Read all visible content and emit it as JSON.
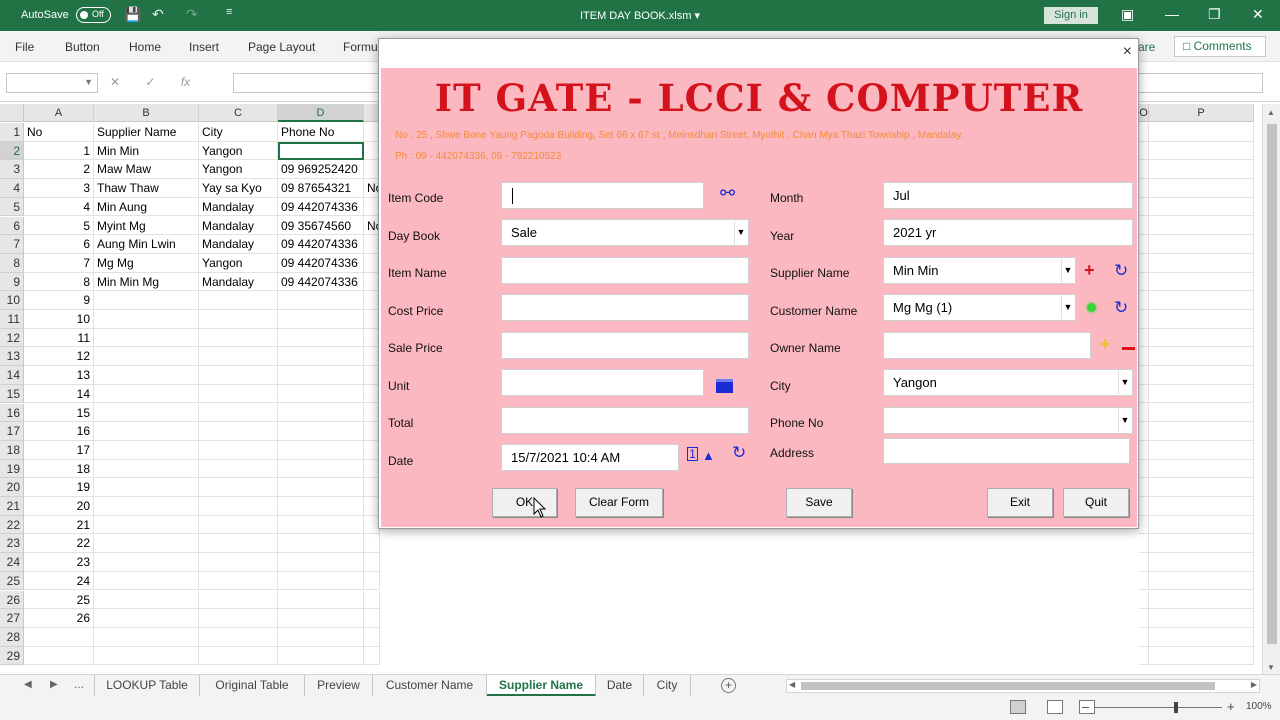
{
  "titlebar": {
    "autosave_label": "AutoSave",
    "autosave_state": "Off",
    "file_title": "ITEM DAY BOOK.xlsm",
    "title_dropdown": "▾",
    "sign_in": "Sign in"
  },
  "ribbon": {
    "tabs": [
      "File",
      "Button",
      "Home",
      "Insert",
      "Page Layout",
      "Formu"
    ],
    "share_partial": "are",
    "comments": "Comments"
  },
  "formula_bar": {
    "fx": "fx",
    "name_box": "",
    "content": ""
  },
  "sheet": {
    "columns": [
      "A",
      "B",
      "C",
      "D",
      "O",
      "P"
    ],
    "active_column": "D",
    "row_numbers": [
      "1",
      "2",
      "3",
      "4",
      "5",
      "6",
      "7",
      "8",
      "9",
      "10",
      "11",
      "12",
      "13",
      "14",
      "15",
      "16",
      "17",
      "18",
      "19",
      "20",
      "21",
      "22",
      "23",
      "24",
      "25",
      "26",
      "27",
      "28",
      "29"
    ],
    "header_row": [
      "No",
      "Supplier Name",
      "City",
      "Phone No"
    ],
    "data_rows": [
      [
        "1",
        "Min Min",
        "Yangon",
        ""
      ],
      [
        "2",
        "Maw Maw",
        "Yangon",
        "09 969252420"
      ],
      [
        "3",
        "Thaw Thaw",
        "Yay sa Kyo",
        "09 87654321"
      ],
      [
        "4",
        "Min Aung",
        "Mandalay",
        "09 442074336"
      ],
      [
        "5",
        "Myint Mg",
        "Mandalay",
        "09 35674560"
      ],
      [
        "6",
        "Aung Min Lwin",
        "Mandalay",
        "09 442074336"
      ],
      [
        "7",
        "Mg Mg",
        "Yangon",
        "09 442074336"
      ],
      [
        "8",
        "Min Min Mg",
        "Mandalay",
        "09 442074336"
      ]
    ],
    "col_e_fragments": {
      "row4": "No",
      "row6": "No"
    },
    "col_a_numbers": [
      "9",
      "10",
      "11",
      "12",
      "13",
      "14",
      "15",
      "16",
      "17",
      "18",
      "19",
      "20",
      "21",
      "22",
      "23",
      "24",
      "25",
      "26"
    ]
  },
  "sheet_tabs": {
    "ellipsis": "...",
    "tabs": [
      "LOOKUP Table",
      "Original Table",
      "Preview",
      "Customer Name",
      "Supplier Name",
      "Date",
      "City"
    ],
    "active": "Supplier Name"
  },
  "statusbar": {
    "zoom": "100%"
  },
  "form": {
    "close": "×",
    "title": "IT GATE - LCCI & COMPUTER",
    "address_line1": "No . 25 , Shwe Bone Yaung Pagoda Building, Set 66 x 67 st , Meinsdhari Street, Myothit , Chan Mya Thazi Township , Mandalay.",
    "address_line2": "Ph : 09 - 442074336, 09 - 792210523",
    "labels": {
      "item_code": "Item Code",
      "day_book": "Day Book",
      "item_name": "Item Name",
      "cost_price": "Cost Price",
      "sale_price": "Sale Price",
      "unit": "Unit",
      "total": "Total",
      "date": "Date",
      "month": "Month",
      "year": "Year",
      "supplier_name": "Supplier Name",
      "customer_name": "Customer Name",
      "owner_name": "Owner Name",
      "city": "City",
      "phone_no": "Phone No",
      "address": "Address"
    },
    "values": {
      "item_code": "",
      "day_book": "Sale",
      "item_name": "",
      "cost_price": "",
      "sale_price": "",
      "unit": "",
      "total": "",
      "date": "15/7/2021 10:4 AM",
      "month": "Jul",
      "year": "2021 yr",
      "supplier_name": "Min Min",
      "customer_name": "Mg Mg (1)",
      "owner_name": "",
      "city": "Yangon",
      "phone_no": "",
      "address": ""
    },
    "buttons": {
      "ok": "OK",
      "clear": "Clear Form",
      "save": "Save",
      "exit": "Exit",
      "quit": "Quit"
    },
    "colors": {
      "background": "#fbb8c0",
      "title": "#d4121b",
      "address": "#f48a38"
    }
  }
}
